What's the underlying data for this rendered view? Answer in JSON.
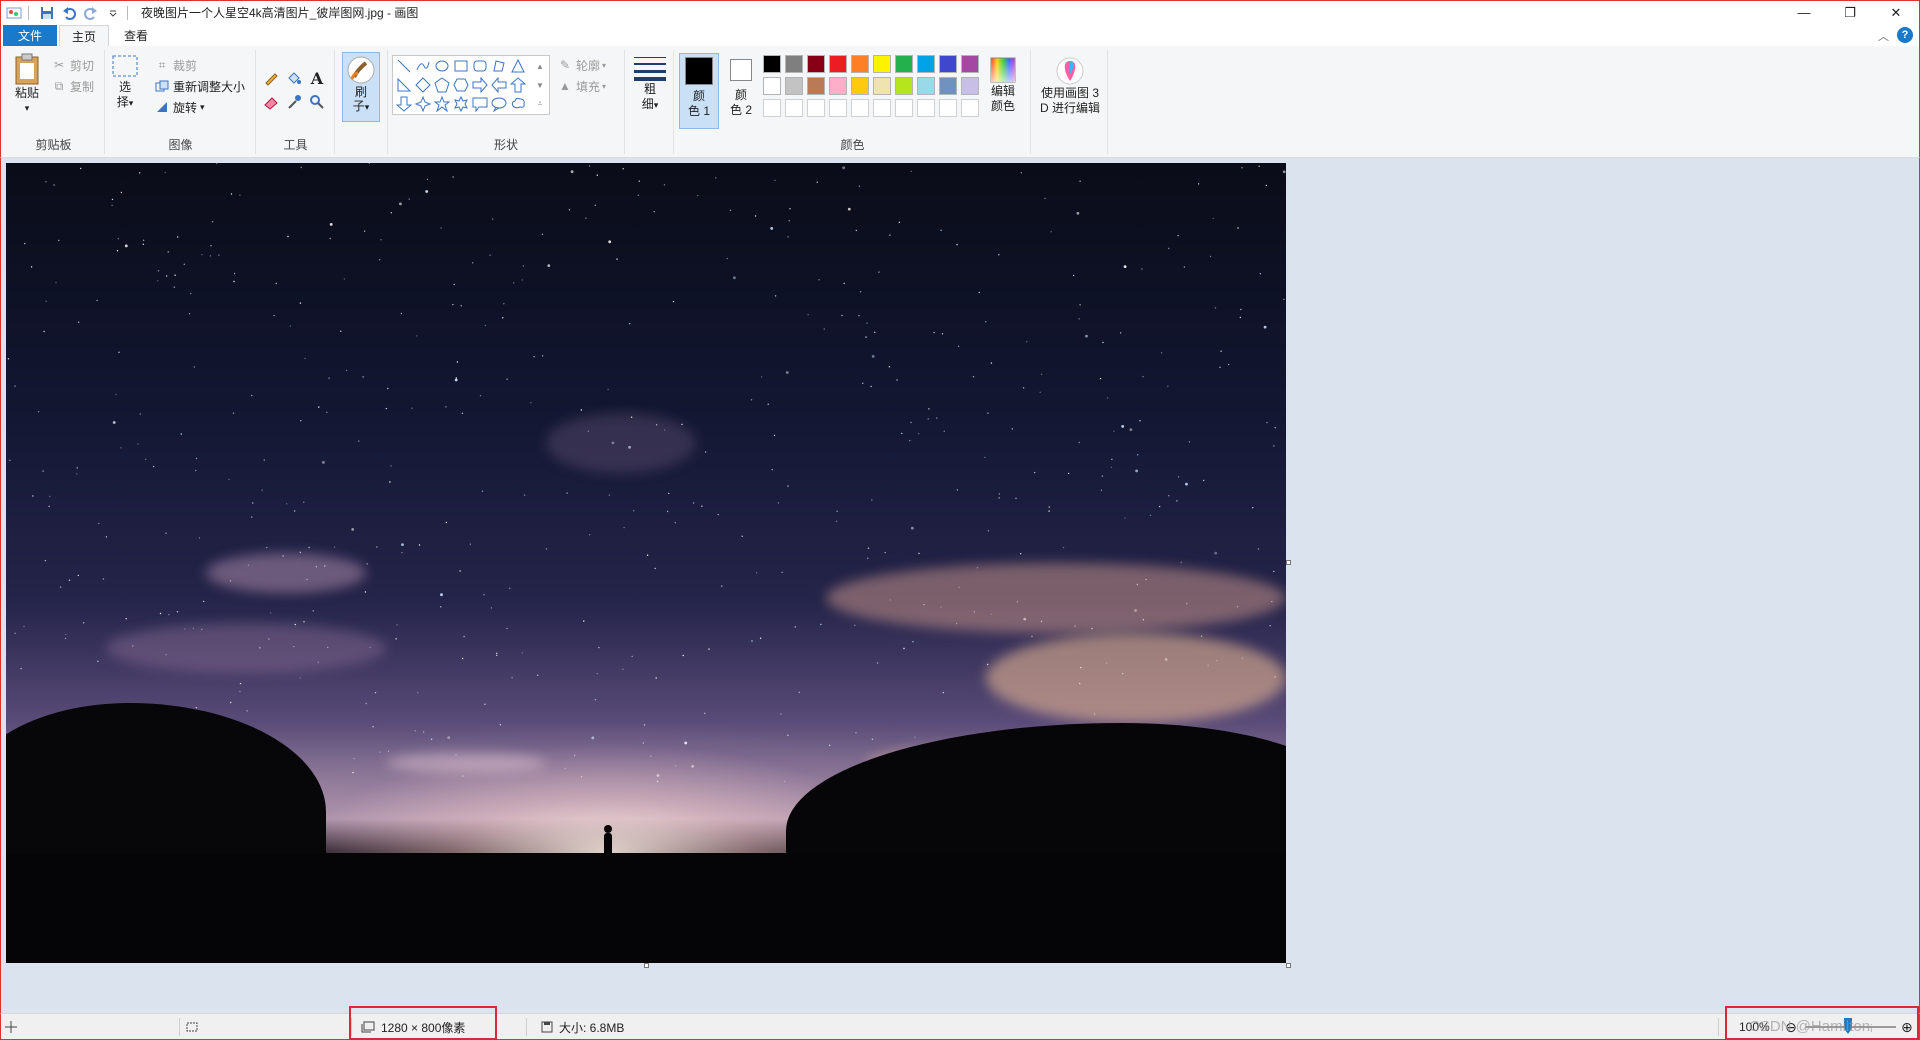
{
  "titlebar": {
    "title": "夜晚图片一个人星空4k高清图片_彼岸图网.jpg - 画图",
    "quick_access": [
      "app-icon",
      "save-icon",
      "undo-icon",
      "redo-icon",
      "customize-icon"
    ],
    "minimize": "—",
    "restore": "❐",
    "close": "✕"
  },
  "tabs": {
    "file": "文件",
    "home": "主页",
    "view": "查看"
  },
  "ribbon": {
    "clipboard": {
      "label": "剪贴板",
      "paste": "粘贴",
      "cut": "剪切",
      "copy": "复制"
    },
    "image": {
      "label": "图像",
      "select_line1": "选",
      "select_line2": "择",
      "crop": "裁剪",
      "resize": "重新调整大小",
      "rotate": "旋转"
    },
    "tools": {
      "label": "工具"
    },
    "brush": {
      "line1": "刷",
      "line2": "子"
    },
    "shapes": {
      "label": "形状",
      "outline": "轮廓",
      "fill": "填充"
    },
    "size": {
      "line1": "粗",
      "line2": "细"
    },
    "colors": {
      "label": "颜色",
      "color1_line1": "颜",
      "color1_line2": "色 1",
      "color2_line1": "颜",
      "color2_line2": "色 2",
      "color1_value": "#000000",
      "color2_value": "#ffffff",
      "edit_line1": "编辑",
      "edit_line2": "颜色",
      "palette_row1": [
        "#000000",
        "#7f7f7f",
        "#880015",
        "#ed1c24",
        "#ff7f27",
        "#fff200",
        "#22b14c",
        "#00a2e8",
        "#3f48cc",
        "#a349a4"
      ],
      "palette_row2": [
        "#ffffff",
        "#c3c3c3",
        "#b97a57",
        "#ffaec9",
        "#ffc90e",
        "#efe4b0",
        "#b5e61d",
        "#99d9ea",
        "#7092be",
        "#c8bfe7"
      ]
    },
    "paint3d": {
      "line1": "使用画图 3",
      "line2": "D 进行编辑"
    }
  },
  "statusbar": {
    "dimensions": "1280 × 800像素",
    "size": "大小: 6.8MB",
    "zoom": "100%",
    "watermark": "CSDN @Hamiltonᵢ"
  }
}
